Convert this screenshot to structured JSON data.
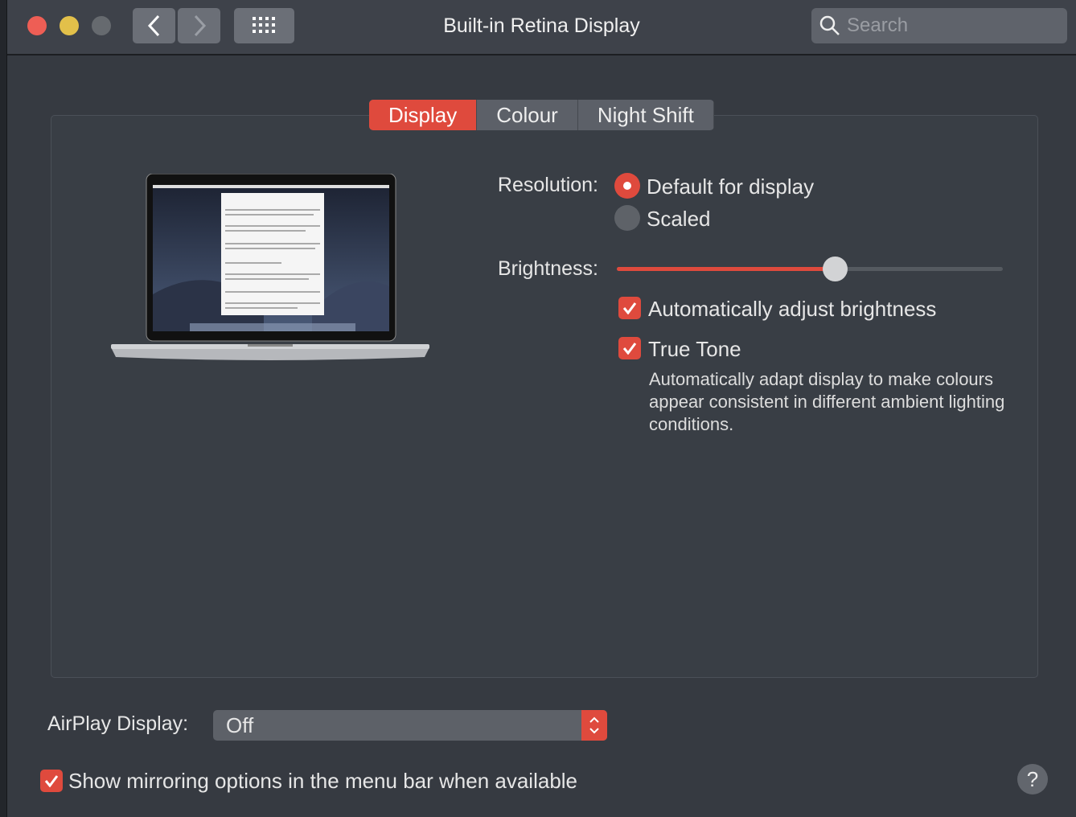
{
  "window": {
    "title": "Built-in Retina Display",
    "search_placeholder": "Search"
  },
  "toolbar": {
    "back_icon": "chevron-left-icon",
    "forward_icon": "chevron-right-icon",
    "grid_icon": "grid-icon"
  },
  "tabs": [
    {
      "label": "Display",
      "active": true
    },
    {
      "label": "Colour",
      "active": false
    },
    {
      "label": "Night Shift",
      "active": false
    }
  ],
  "resolution": {
    "label": "Resolution:",
    "options": [
      {
        "label": "Default for display",
        "selected": true
      },
      {
        "label": "Scaled",
        "selected": false
      }
    ]
  },
  "brightness": {
    "label": "Brightness:",
    "value": 0.565
  },
  "auto_brightness": {
    "label": "Automatically adjust brightness",
    "checked": true
  },
  "true_tone": {
    "label": "True Tone",
    "checked": true,
    "description": "Automatically adapt display to make colours appear consistent in different ambient lighting conditions."
  },
  "airplay": {
    "label": "AirPlay Display:",
    "value": "Off"
  },
  "mirroring": {
    "label": "Show mirroring options in the menu bar when available",
    "checked": true
  },
  "help": {
    "label": "?"
  },
  "colors": {
    "accent": "#df4a3d",
    "close": "#ee5e55",
    "minimize": "#e2c04a",
    "background": "#363a41"
  }
}
